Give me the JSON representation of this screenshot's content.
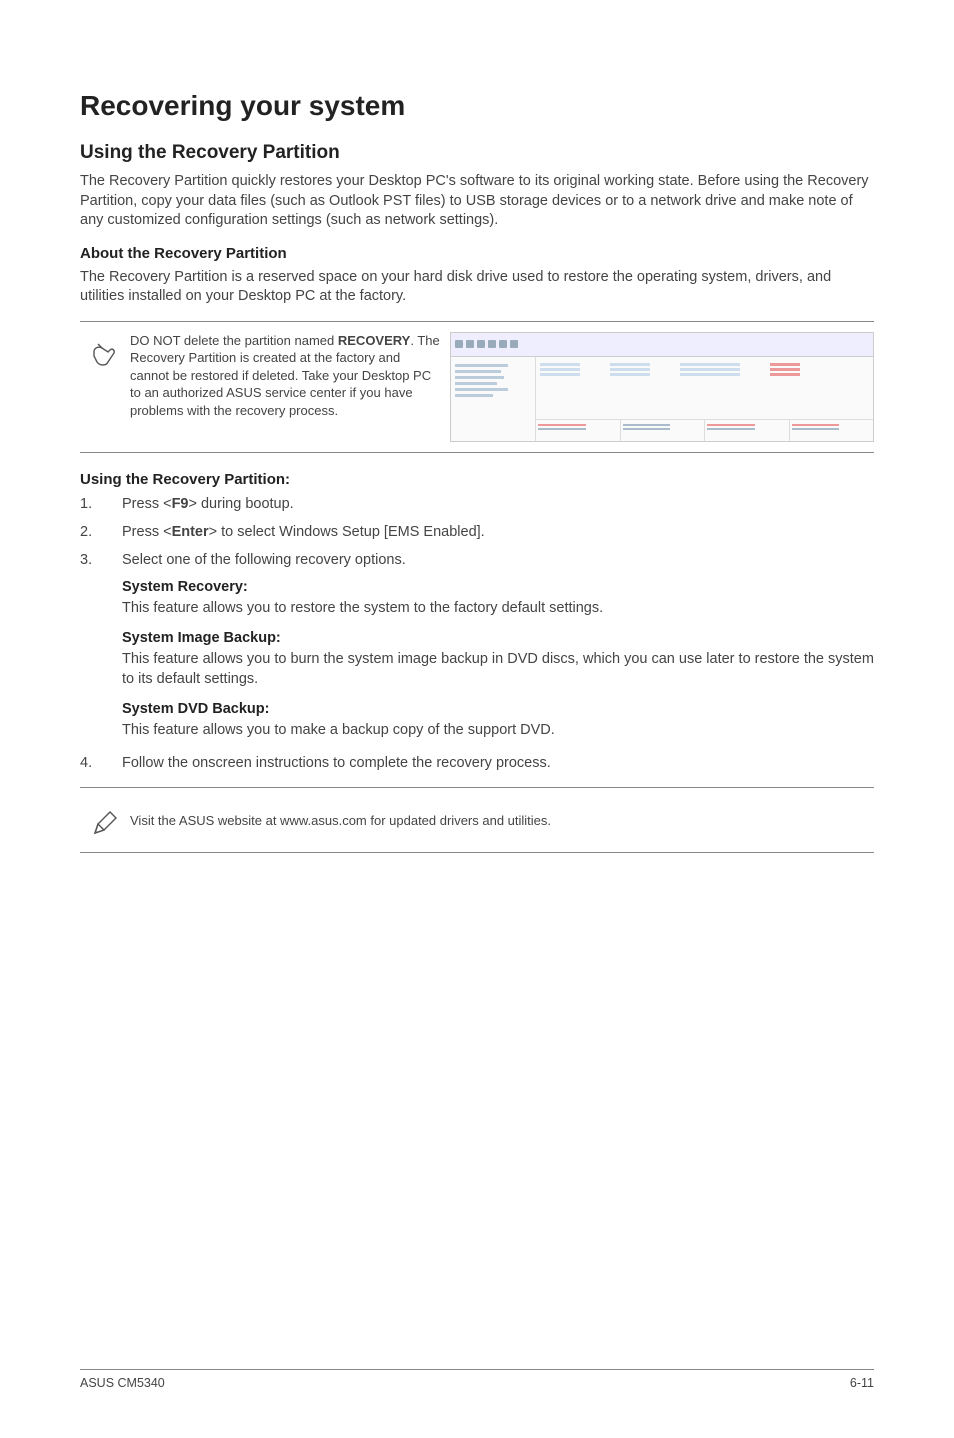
{
  "title": "Recovering your system",
  "section1": {
    "heading": "Using the Recovery Partition",
    "para": "The Recovery Partition quickly restores your Desktop PC's software to its original working state. Before using the Recovery Partition, copy your data files (such as Outlook PST files) to USB storage devices or to a network drive and make note of any customized configuration settings (such as network settings)."
  },
  "about": {
    "heading": "About the Recovery Partition",
    "para": "The Recovery Partition is a reserved space on your hard disk drive used to restore the operating system, drivers, and utilities installed on your Desktop PC at the factory."
  },
  "note1": {
    "pre": "DO NOT delete the partition named ",
    "bold": "RECOVERY",
    "post": ". The Recovery Partition is created at the factory and cannot be restored if deleted. Take your Desktop PC to an authorized ASUS service center if you have problems with the recovery process."
  },
  "using": {
    "heading": "Using the Recovery Partition:",
    "steps": [
      {
        "num": "1.",
        "pre": "Press <",
        "key": "F9",
        "post": "> during bootup."
      },
      {
        "num": "2.",
        "pre": "Press <",
        "key": "Enter",
        "post": "> to select Windows Setup [EMS Enabled]."
      },
      {
        "num": "3.",
        "text": "Select one of the following recovery options."
      }
    ],
    "options": [
      {
        "title": "System Recovery:",
        "desc": "This feature allows you to restore the system to the factory default settings."
      },
      {
        "title": "System Image Backup:",
        "desc": "This feature allows you to burn the system image backup in DVD discs, which you can use later to restore the system to its default settings."
      },
      {
        "title": "System DVD Backup:",
        "desc": "This feature allows you to make a backup copy of the support DVD."
      }
    ],
    "step4": {
      "num": "4.",
      "text": "Follow the onscreen instructions to complete the recovery process."
    }
  },
  "note2": "Visit the ASUS website at www.asus.com for updated drivers and utilities.",
  "footer": {
    "left": "ASUS CM5340",
    "right": "6-11"
  }
}
